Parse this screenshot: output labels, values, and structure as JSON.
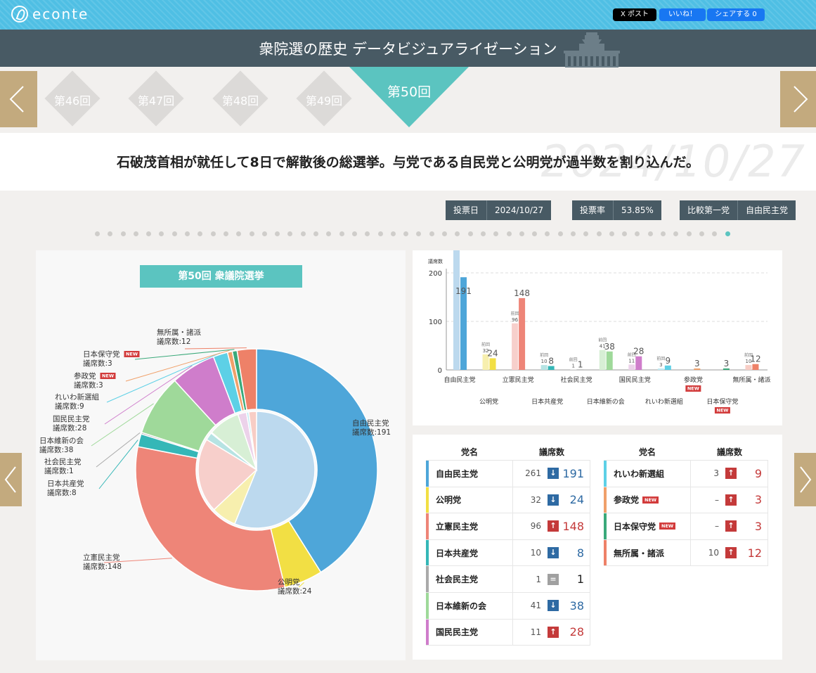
{
  "brand": "econte",
  "share": {
    "x": "X ポスト",
    "like": "いいね！",
    "fb": "シェアする 0"
  },
  "site_title": "衆院選の歴史 データビジュアライゼーション",
  "nav": {
    "elections": [
      {
        "label": "第46回"
      },
      {
        "label": "第47回"
      },
      {
        "label": "第48回"
      },
      {
        "label": "第49回"
      },
      {
        "label": "第50回",
        "active": true
      }
    ]
  },
  "summary": {
    "text": "石破茂首相が就任して8日で解散後の総選挙。与党である自民党と公明党が過半数を割り込んだ。",
    "watermark": "2024/10/27"
  },
  "info": [
    {
      "key": "投票日",
      "value": "2024/10/27"
    },
    {
      "key": "投票率",
      "value": "53.85%"
    },
    {
      "key": "比較第一党",
      "value": "自由民主党"
    }
  ],
  "pie": {
    "title": "第50回 衆議院選挙",
    "seat_label": "議席数:",
    "new_label": "NEW"
  },
  "chart_data": {
    "type": "bar",
    "ylabel": "議席数",
    "ylim": [
      0,
      200
    ],
    "yticks": [
      0,
      100,
      200
    ],
    "prev_tag": "前回",
    "new_label": "NEW",
    "categories": [
      "自由民主党",
      "公明党",
      "立憲民主党",
      "日本共産党",
      "社会民主党",
      "日本維新の会",
      "国民民主党",
      "れいわ新選組",
      "参政党",
      "日本保守党",
      "無所属・諸派"
    ],
    "series": [
      {
        "values": [
          261,
          32,
          96,
          10,
          1,
          41,
          11,
          3,
          null,
          null,
          10
        ]
      },
      {
        "values": [
          191,
          24,
          148,
          8,
          1,
          38,
          28,
          9,
          3,
          3,
          12
        ]
      }
    ],
    "colors": [
      "#4ea6d9",
      "#f2df44",
      "#ee8578",
      "#35b7b7",
      "#aaaaaa",
      "#9fd99a",
      "#cf7dcb",
      "#5dd0e6",
      "#f0a06a",
      "#3aa97a",
      "#ee8168"
    ],
    "light_colors": [
      "#bcd9ee",
      "#f7efae",
      "#f7cfcb",
      "#b6e3e3",
      "#d9d9d9",
      "#d7efd5",
      "#ecd2ea",
      "#c2ecf5",
      "#f8d8c0",
      "#bfe3d2",
      "#f8cdc5"
    ],
    "is_new": [
      false,
      false,
      false,
      false,
      false,
      false,
      false,
      false,
      true,
      true,
      false
    ],
    "table_headers": {
      "name": "党名",
      "seats": "議席数"
    },
    "prev_display": [
      "261",
      "32",
      "96",
      "10",
      "1",
      "41",
      "11",
      "3",
      "–",
      "–",
      "10"
    ],
    "change": [
      "down",
      "down",
      "up",
      "down",
      "same",
      "down",
      "up",
      "up",
      "up",
      "up",
      "up"
    ]
  }
}
